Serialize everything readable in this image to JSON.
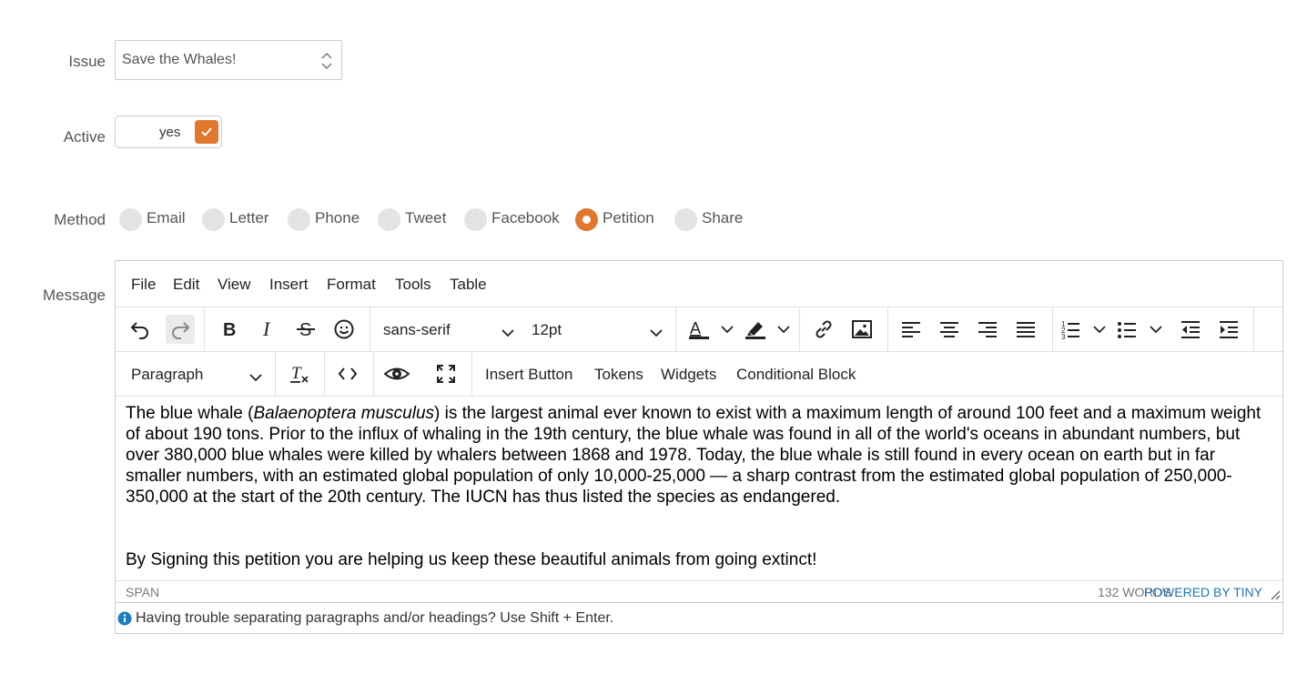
{
  "issue": {
    "label": "Issue",
    "value": "Save the Whales!"
  },
  "active": {
    "label": "Active",
    "value": "yes",
    "checked": true,
    "accent_color": "#e0772c"
  },
  "method": {
    "label": "Method",
    "options": [
      "Email",
      "Letter",
      "Phone",
      "Tweet",
      "Facebook",
      "Petition",
      "Share"
    ],
    "selected": "Petition"
  },
  "message": {
    "label": "Message",
    "menubar": [
      "File",
      "Edit",
      "View",
      "Insert",
      "Format",
      "Tools",
      "Table"
    ],
    "toolbar": {
      "font_family": "sans-serif",
      "font_size": "12pt",
      "block_format": "Paragraph",
      "insert_button": "Insert Button",
      "tokens": "Tokens",
      "widgets": "Widgets",
      "conditional_block": "Conditional Block"
    },
    "content": {
      "p1_before": "The blue whale (",
      "p1_italic": "Balaenoptera musculus",
      "p1_after": ") is the largest animal ever known to exist with a maximum length of around 100 feet and a maximum weight of about 190 tons. Prior to the influx of whaling in the 19th century, the blue whale was found in all of the world's oceans in abundant numbers, but over 380,000 blue whales were killed by whalers between 1868 and 1978. Today, the blue whale is still found in every ocean on earth but in far smaller numbers, with an estimated global population of only 10,000-25,000 — a sharp contrast from the estimated global population of 250,000-350,000 at the start of the 20th century. The IUCN has thus listed the species as endangered.",
      "p2": "By Signing this petition you are helping us keep these beautiful animals from going extinct!"
    },
    "statusbar": {
      "path": "SPAN",
      "word_count": "132 WORDS",
      "powered_by": "POWERED BY TINY"
    },
    "help_text": "Having trouble separating paragraphs and/or headings? Use Shift + Enter."
  }
}
